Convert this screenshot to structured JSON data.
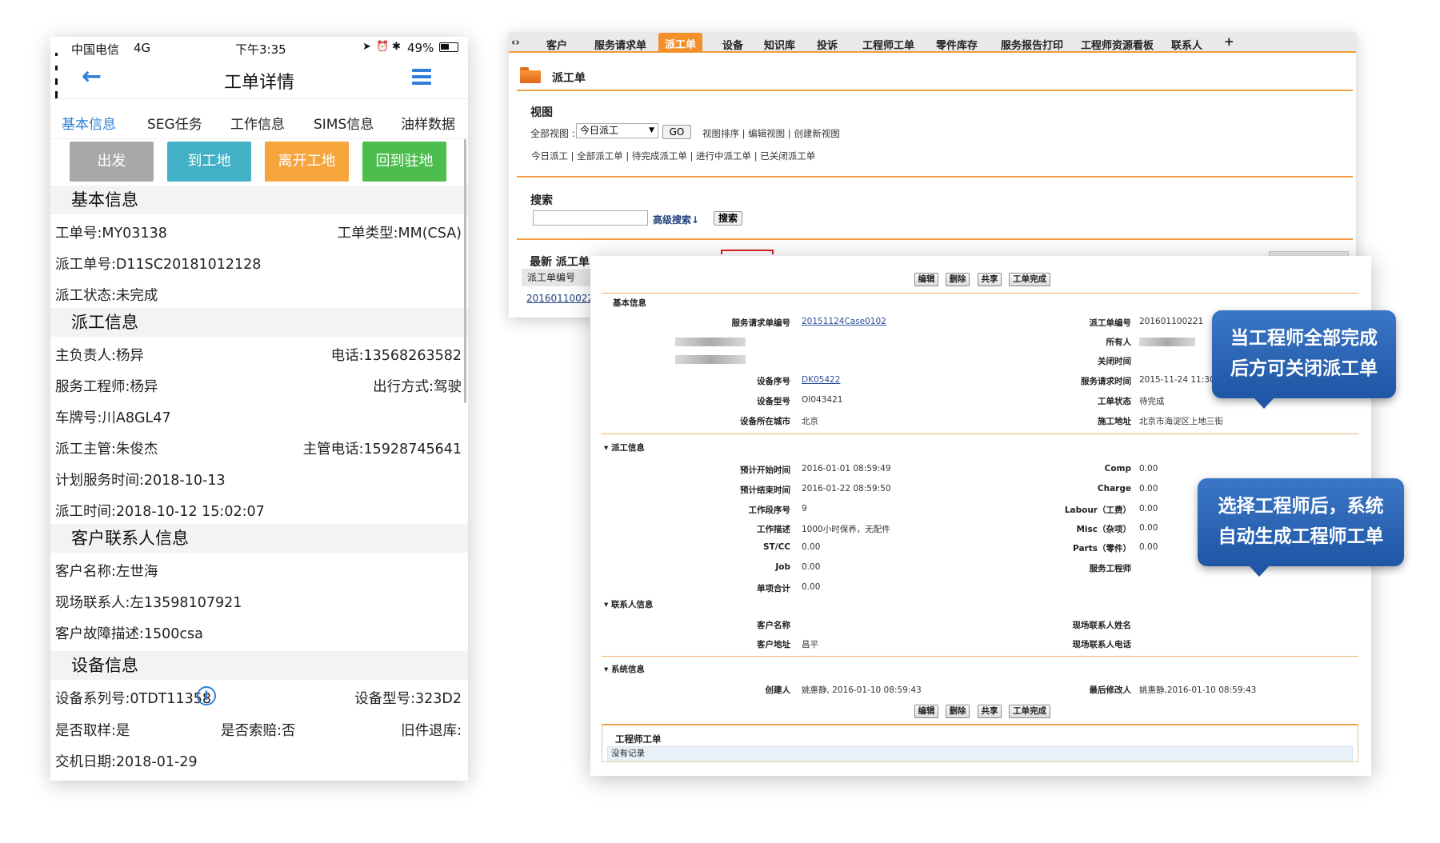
{
  "phone": {
    "status": {
      "carrier": "中国电信",
      "network": "4G",
      "time": "下午3:35",
      "battery": "49%"
    },
    "title": "工单详情",
    "tabs": [
      "基本信息",
      "SEG任务",
      "工作信息",
      "SIMS信息",
      "油样数据"
    ],
    "active_tab": 0,
    "actions": [
      {
        "label": "出发",
        "color": "#a8a8a8"
      },
      {
        "label": "到工地",
        "color": "#43b1c5"
      },
      {
        "label": "离开工地",
        "color": "#f6a43c"
      },
      {
        "label": "回到驻地",
        "color": "#4dbd4d"
      }
    ],
    "sections": {
      "basic": {
        "title": "基本信息",
        "order_no": "工单号:MY03138",
        "order_type": "工单类型:MM(CSA)",
        "dispatch_no": "派工单号:D11SC20181012128",
        "dispatch_status": "派工状态:未完成"
      },
      "dispatch": {
        "title": "派工信息",
        "owner": "主负责人:杨异",
        "phone": "电话:13568263582",
        "engineer": "服务工程师:杨异",
        "travel": "出行方式:驾驶",
        "plate": "车牌号:川A8GL47",
        "supervisor": "派工主管:朱俊杰",
        "supervisor_phone": "主管电话:15928745641",
        "plan_time": "计划服务时间:2018-10-13",
        "dispatch_time": "派工时间:2018-10-12 15:02:07"
      },
      "customer": {
        "title": "客户联系人信息",
        "name": "客户名称:左世海",
        "contact": "现场联系人:左13598107921",
        "fault": "客户故障描述:1500csa"
      },
      "equipment": {
        "title": "设备信息",
        "serial": "设备系列号:0TDT11358",
        "model": "设备型号:323D2",
        "sampled": "是否取样:是",
        "claim": "是否索赔:否",
        "returned": "旧件退库:",
        "delivery": "交机日期:2018-01-29"
      }
    }
  },
  "web": {
    "nav": [
      "客户",
      "服务请求单",
      "派工单",
      "设备",
      "知识库",
      "投诉",
      "工程师工单",
      "零件库存",
      "服务报告打印",
      "工程师资源看板",
      "联系人",
      "+"
    ],
    "active_nav": 2,
    "page_title": "派工单",
    "view": {
      "label": "视图",
      "all_views": "全部视图 :",
      "selected": "今日派工",
      "go": "GO",
      "links": "视图排序 | 编辑视图 | 创建新视图",
      "filters": "今日派工 | 全部派工单 | 待完成派工单 | 进行中派工单 | 已关闭派工单"
    },
    "search": {
      "label": "搜索",
      "advanced": "高级搜索↓",
      "button": "搜索"
    },
    "recent": {
      "title": "最新 派工单",
      "col": "派工单编号",
      "row": "201601100221"
    }
  },
  "detail": {
    "buttons": [
      "编辑",
      "删除",
      "共享",
      "工单完成"
    ],
    "basic_title": "基本信息",
    "sr_no_key": "服务请求单编号",
    "sr_no": "20151124Case0102",
    "dispatch_no_key": "派工单编号",
    "dispatch_no": "201601100221",
    "owner_key": "所有人",
    "close_time_key": "关闭时间",
    "equip_no_key": "设备序号",
    "equip_no": "DK05422",
    "sr_time_key": "服务请求时间",
    "sr_time": "2015-11-24 11:30:1",
    "model_key": "设备型号",
    "model": "OI043421",
    "status_key": "工单状态",
    "status": "待完成",
    "city_key": "设备所在城市",
    "city": "北京",
    "site_key": "施工地址",
    "site": "北京市海淀区上地三街",
    "dispatch_title": "派工信息",
    "plan_start_key": "预计开始时间",
    "plan_start": "2016-01-01 08:59:49",
    "plan_end_key": "预计结束时间",
    "plan_end": "2016-01-22 08:59:50",
    "segment_key": "工作段序号",
    "segment": "9",
    "desc_key": "工作描述",
    "desc": "1000小时保养，无配件",
    "stcc_key": "ST/CC",
    "stcc": "0.00",
    "job_key": "Job",
    "job": "0.00",
    "subtotal_key": "单项合计",
    "subtotal": "0.00",
    "comp_key": "Comp",
    "comp": "0.00",
    "charge_key": "Charge",
    "charge": "0.00",
    "labour_key": "Labour（工费）",
    "labour": "0.00",
    "misc_key": "Misc（杂项）",
    "misc": "0.00",
    "parts_key": "Parts（零件）",
    "parts": "0.00",
    "engineer_key": "服务工程师",
    "contact_title": "联系人信息",
    "cust_name_key": "客户名称",
    "cust_addr_key": "客户地址",
    "cust_addr": "昌平",
    "site_contact_key": "现场联系人姓名",
    "site_phone_key": "现场联系人电话",
    "system_title": "系统信息",
    "creator_key": "创建人",
    "creator": "姚惠静, 2016-01-10 08:59:43",
    "modifier_key": "最后修改人",
    "modifier": "姚惠静,2016-01-10 08:59:43",
    "eng_orders_title": "工程师工单",
    "no_records": "没有记录"
  },
  "callouts": [
    {
      "line1": "当工程师全部完成",
      "line2": "后方可关闭派工单"
    },
    {
      "line1": "选择工程师后，系统",
      "line2": "自动生成工程师工单"
    }
  ]
}
